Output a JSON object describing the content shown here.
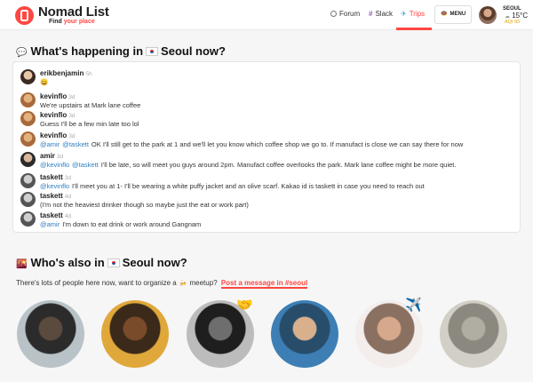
{
  "header": {
    "brand": "Nomad List",
    "tagline_prefix": "Find ",
    "tagline_highlight": "your place",
    "nav": [
      {
        "label": "Forum",
        "icon": "chat-bubble-icon"
      },
      {
        "label": "Slack",
        "icon": "slack-icon"
      },
      {
        "label": "Trips",
        "icon": "airplane-icon",
        "active": true
      }
    ],
    "menu_label": "MENU",
    "menu_icon": "🍩",
    "location": {
      "city": "SEOUL",
      "temperature": "15°C",
      "weather_icon": "☁",
      "aqi": "AQI 93"
    }
  },
  "happening": {
    "icon": "💬",
    "title_prefix": "What's happening in",
    "city": "Seoul now?",
    "messages": [
      {
        "user": "erikbenjamin",
        "ago": "5h",
        "text": "😄",
        "mentions": [],
        "avatar_colors": [
          "#e6c7a8",
          "#3a2a22"
        ]
      },
      {
        "user": "kevinflo",
        "ago": "3d",
        "text": "We're upstairs at Mark lane coffee",
        "mentions": [],
        "avatar_colors": [
          "#e4b27e",
          "#a86a3a"
        ]
      },
      {
        "user": "kevinflo",
        "ago": "3d",
        "text": "Guess I'll be a few min late too lol",
        "mentions": [],
        "avatar_colors": [
          "#e4b27e",
          "#a86a3a"
        ]
      },
      {
        "user": "kevinflo",
        "ago": "3d",
        "text": "OK I'll still get to the park at 1 and we'll let you know which coffee shop we go to. If manufact is close we can say there for now",
        "mentions": [
          "@amir",
          "@taskett"
        ],
        "avatar_colors": [
          "#e4b27e",
          "#a86a3a"
        ]
      },
      {
        "user": "amir",
        "ago": "3d",
        "text": "I'll be late, so will meet you guys around 2pm. Manufact coffee overlooks the park. Mark lane coffee might be more quiet.",
        "mentions": [
          "@kevinflo",
          "@taskett"
        ],
        "avatar_colors": [
          "#d9b89a",
          "#2a2a2a"
        ]
      },
      {
        "user": "taskett",
        "ago": "3d",
        "text": "I'll meet you at 1- I'll be wearing a white puffy jacket and an olive scarf. Kakao id is taskett in case you need to reach out",
        "mentions": [
          "@kevinflo"
        ],
        "avatar_colors": [
          "#cfcfcf",
          "#555555"
        ]
      },
      {
        "user": "taskett",
        "ago": "4d",
        "text": "(I'm not the heaviest drinker though so maybe just the eat or work part)",
        "mentions": [],
        "avatar_colors": [
          "#cfcfcf",
          "#555555"
        ]
      },
      {
        "user": "taskett",
        "ago": "4d",
        "text": "I'm down to eat drink or work around Gangnam",
        "mentions": [
          "@amir"
        ],
        "avatar_colors": [
          "#cfcfcf",
          "#555555"
        ]
      }
    ]
  },
  "also_in": {
    "icon": "🌇",
    "title_prefix": "Who's also in",
    "city": "Seoul now?",
    "organize_prefix": "There's lots of people here now, want to organize a",
    "organize_icon": "🍻",
    "organize_suffix": "meetup?",
    "post_link": "Post a message in #seoul",
    "people": [
      {
        "name": "person-1",
        "emoji": "",
        "bg": [
          "#b9c2c7",
          "#5b4a3e",
          "#2b2b2b"
        ]
      },
      {
        "name": "person-2",
        "emoji": "",
        "bg": [
          "#e0a83a",
          "#7a4b2a",
          "#3b2a1a"
        ]
      },
      {
        "name": "person-3",
        "emoji": "🤝",
        "bg": [
          "#bcbcbc",
          "#6e6e6e",
          "#1e1e1e"
        ]
      },
      {
        "name": "person-4",
        "emoji": "",
        "bg": [
          "#3d7fb4",
          "#d9b08c",
          "#274d6b"
        ]
      },
      {
        "name": "person-5",
        "emoji": "✈️",
        "bg": [
          "#f3eeec",
          "#d6a98c",
          "#8a7060"
        ]
      },
      {
        "name": "person-6",
        "emoji": "",
        "bg": [
          "#d2d0c6",
          "#b0ada2",
          "#8b897f"
        ]
      }
    ]
  }
}
